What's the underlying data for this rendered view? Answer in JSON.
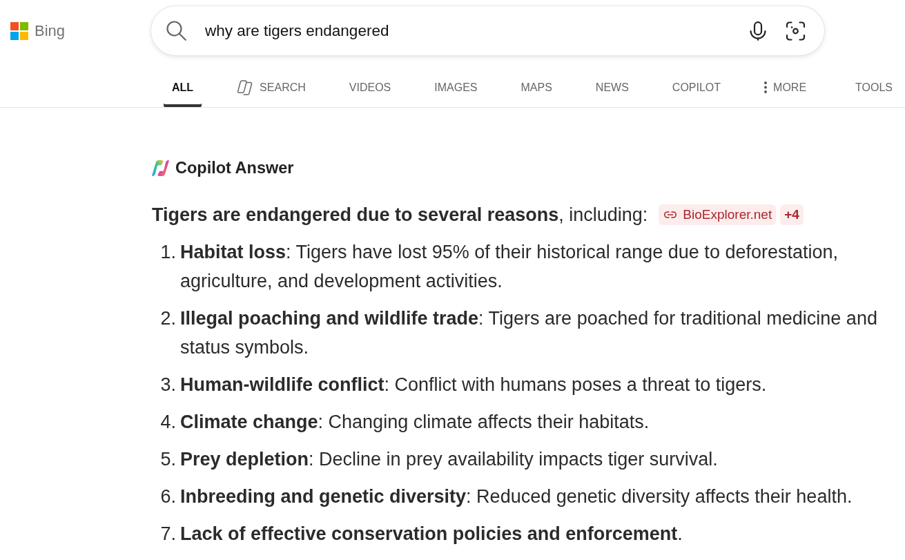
{
  "logo": {
    "text": "Bing"
  },
  "search": {
    "value": "why are tigers endangered"
  },
  "tabs": [
    {
      "label": "ALL",
      "selected": true,
      "kind": "plain"
    },
    {
      "label": "SEARCH",
      "selected": false,
      "kind": "search"
    },
    {
      "label": "VIDEOS",
      "selected": false,
      "kind": "plain"
    },
    {
      "label": "IMAGES",
      "selected": false,
      "kind": "plain"
    },
    {
      "label": "MAPS",
      "selected": false,
      "kind": "plain"
    },
    {
      "label": "NEWS",
      "selected": false,
      "kind": "plain"
    },
    {
      "label": "COPILOT",
      "selected": false,
      "kind": "plain"
    },
    {
      "label": "MORE",
      "selected": false,
      "kind": "more"
    }
  ],
  "tools": {
    "label": "TOOLS"
  },
  "answer": {
    "title": "Copilot Answer",
    "intro": "**Tigers are endangered due to several reasons**, including:",
    "citations": [
      {
        "label": "BioExplorer.net",
        "kind": "link"
      },
      {
        "label": "+4",
        "kind": "count"
      }
    ],
    "items": [
      {
        "number": "1.",
        "text": "**Habitat loss**: Tigers have lost 95% of their historical range due to deforestation, agriculture, and development activities."
      },
      {
        "number": "2.",
        "text": "**Illegal poaching and wildlife trade**: Tigers are poached for traditional medicine and status symbols."
      },
      {
        "number": "3.",
        "text": "**Human-wildlife conflict**: Conflict with humans poses a threat to tigers."
      },
      {
        "number": "4.",
        "text": "**Climate change**: Changing climate affects their habitats."
      },
      {
        "number": "5.",
        "text": "**Prey depletion**: Decline in prey availability impacts tiger survival."
      },
      {
        "number": "6.",
        "text": "**Inbreeding and genetic diversity**: Reduced genetic diversity affects their health."
      },
      {
        "number": "7.",
        "text": "**Lack of effective conservation policies and enforcement**."
      }
    ]
  }
}
